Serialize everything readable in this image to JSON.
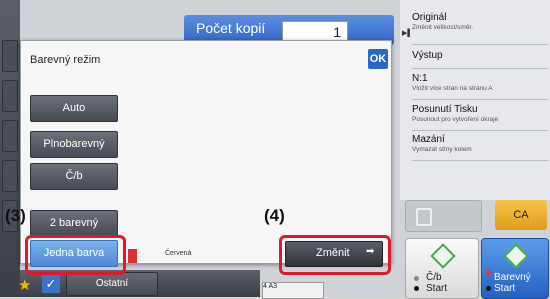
{
  "header": {
    "copies_label": "Počet kopií",
    "copies_value": "1"
  },
  "right_panel": {
    "items": [
      {
        "title": "Originál",
        "subtitle": "Změnit velikost/směr."
      },
      {
        "title": "Výstup",
        "subtitle": ""
      },
      {
        "title": "N:1",
        "subtitle": "Vložit více stran na stranu A"
      },
      {
        "title": "Posunutí Tisku",
        "subtitle": "Posunout pro vytvoření okraje"
      },
      {
        "title": "Mazání",
        "subtitle": "Vymazat stíny kolem"
      }
    ],
    "ca_label": "CA",
    "bw_start_line1": "Č/b",
    "bw_start_line2": "Start",
    "color_start_line1": "Barevný",
    "color_start_line2": "Start"
  },
  "dialog": {
    "title": "Barevný režim",
    "ok_label": "OK",
    "options": {
      "auto": "Auto",
      "full_color": "Plnobarevný",
      "bw": "Č/b",
      "two_color": "2 barevný",
      "single_color": "Jedna barva"
    },
    "selected_color_name": "Červená",
    "change_label": "Změnit"
  },
  "annotations": {
    "step3": "(3)",
    "step4": "(4)"
  },
  "bottom_bar": {
    "other_label": "Ostatní",
    "tray_text": "4 A3"
  },
  "colors": {
    "highlight": "#e0182d",
    "selected_button": "#5f9ae0",
    "swatch": "#e32c2c",
    "ca_button": "#f0b43a",
    "color_start": "#2f6fd0"
  }
}
